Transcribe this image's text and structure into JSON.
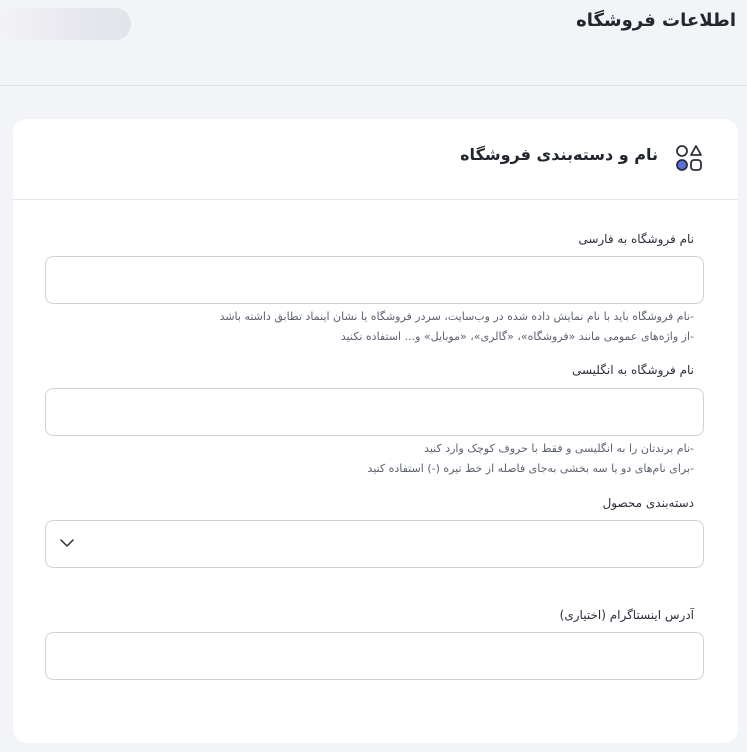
{
  "header": {
    "title": "اطلاعات فروشگاه"
  },
  "card": {
    "title": "نام و دسته‌بندی فروشگاه",
    "icon": "category-shapes-icon"
  },
  "fields": {
    "store_name_fa": {
      "label": "نام فروشگاه به فارسی",
      "value": "",
      "hints": [
        "-نام فروشگاه باید با نام نمایش داده شده در وب‌سایت، سردر فروشگاه یا نشان اینماد تطابق داشته باشد",
        "-از واژه‌های عمومی مانند «فروشگاه»، «گالری»، «موبایل» و... استفاده نکنید"
      ]
    },
    "store_name_en": {
      "label": "نام فروشگاه به انگلیسی",
      "value": "",
      "hints": [
        "-نام برندتان را به انگلیسی و فقط با حروف کوچک وارد کنید",
        "-برای نام‌های دو یا سه بخشی به‌جای فاصله از خط تیره (-) استفاده کنید"
      ]
    },
    "category": {
      "label": "دسته‌بندی محصول",
      "selected": "",
      "icon": "chevron-down-icon"
    },
    "instagram": {
      "label": "آدرس اینستاگرام (اختیاری)",
      "value": ""
    }
  },
  "colors": {
    "page_bg": "#f3f4f7",
    "card_bg": "#ffffff",
    "border": "#cfd2da",
    "text": "#2b2f3a",
    "hint_text": "#5d6270",
    "icon_accent": "#5b6ee1"
  }
}
